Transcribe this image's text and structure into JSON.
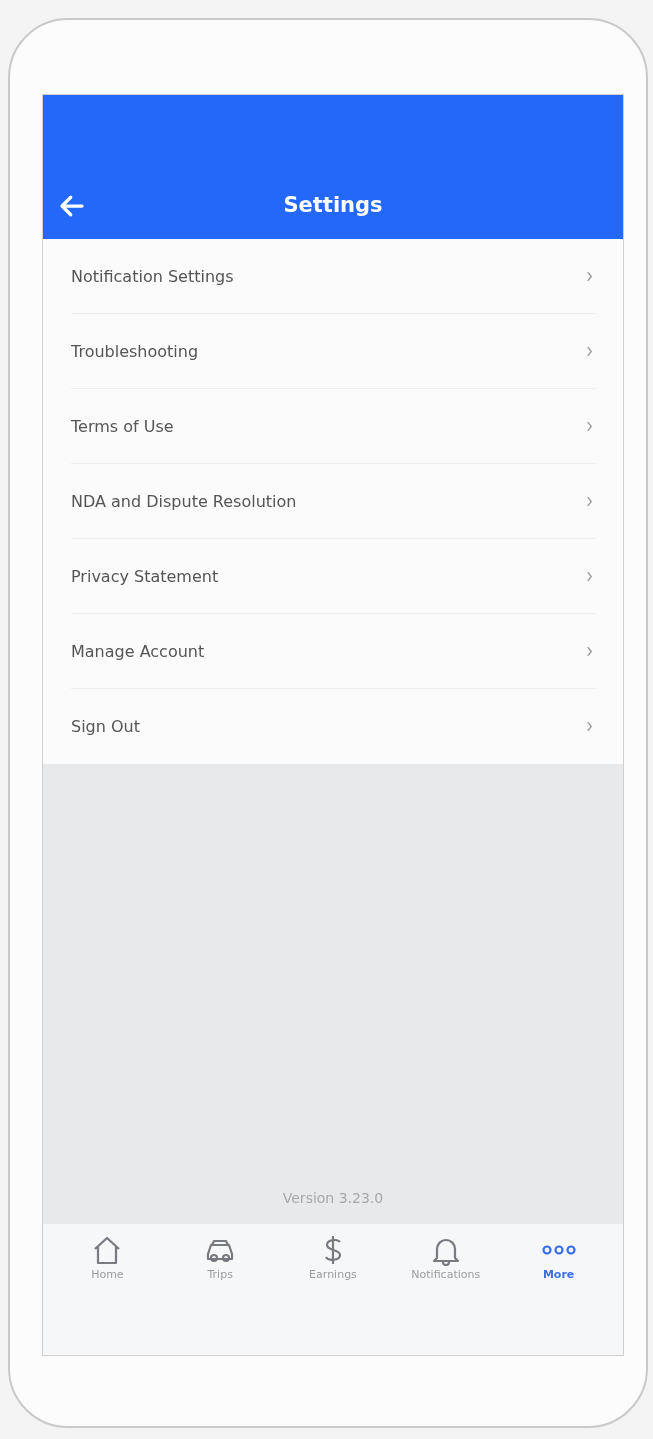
{
  "header": {
    "title": "Settings"
  },
  "menu_items": [
    {
      "label": "Notification Settings"
    },
    {
      "label": "Troubleshooting"
    },
    {
      "label": "Terms of Use"
    },
    {
      "label": "NDA and Dispute Resolution"
    },
    {
      "label": "Privacy Statement"
    },
    {
      "label": "Manage Account"
    },
    {
      "label": "Sign Out"
    }
  ],
  "version": "Version 3.23.0",
  "tab_bar": [
    {
      "label": "Home",
      "selected": false
    },
    {
      "label": "Trips",
      "selected": false
    },
    {
      "label": "Earnings",
      "selected": false
    },
    {
      "label": "Notifications",
      "selected": false
    },
    {
      "label": "More",
      "selected": true
    }
  ]
}
